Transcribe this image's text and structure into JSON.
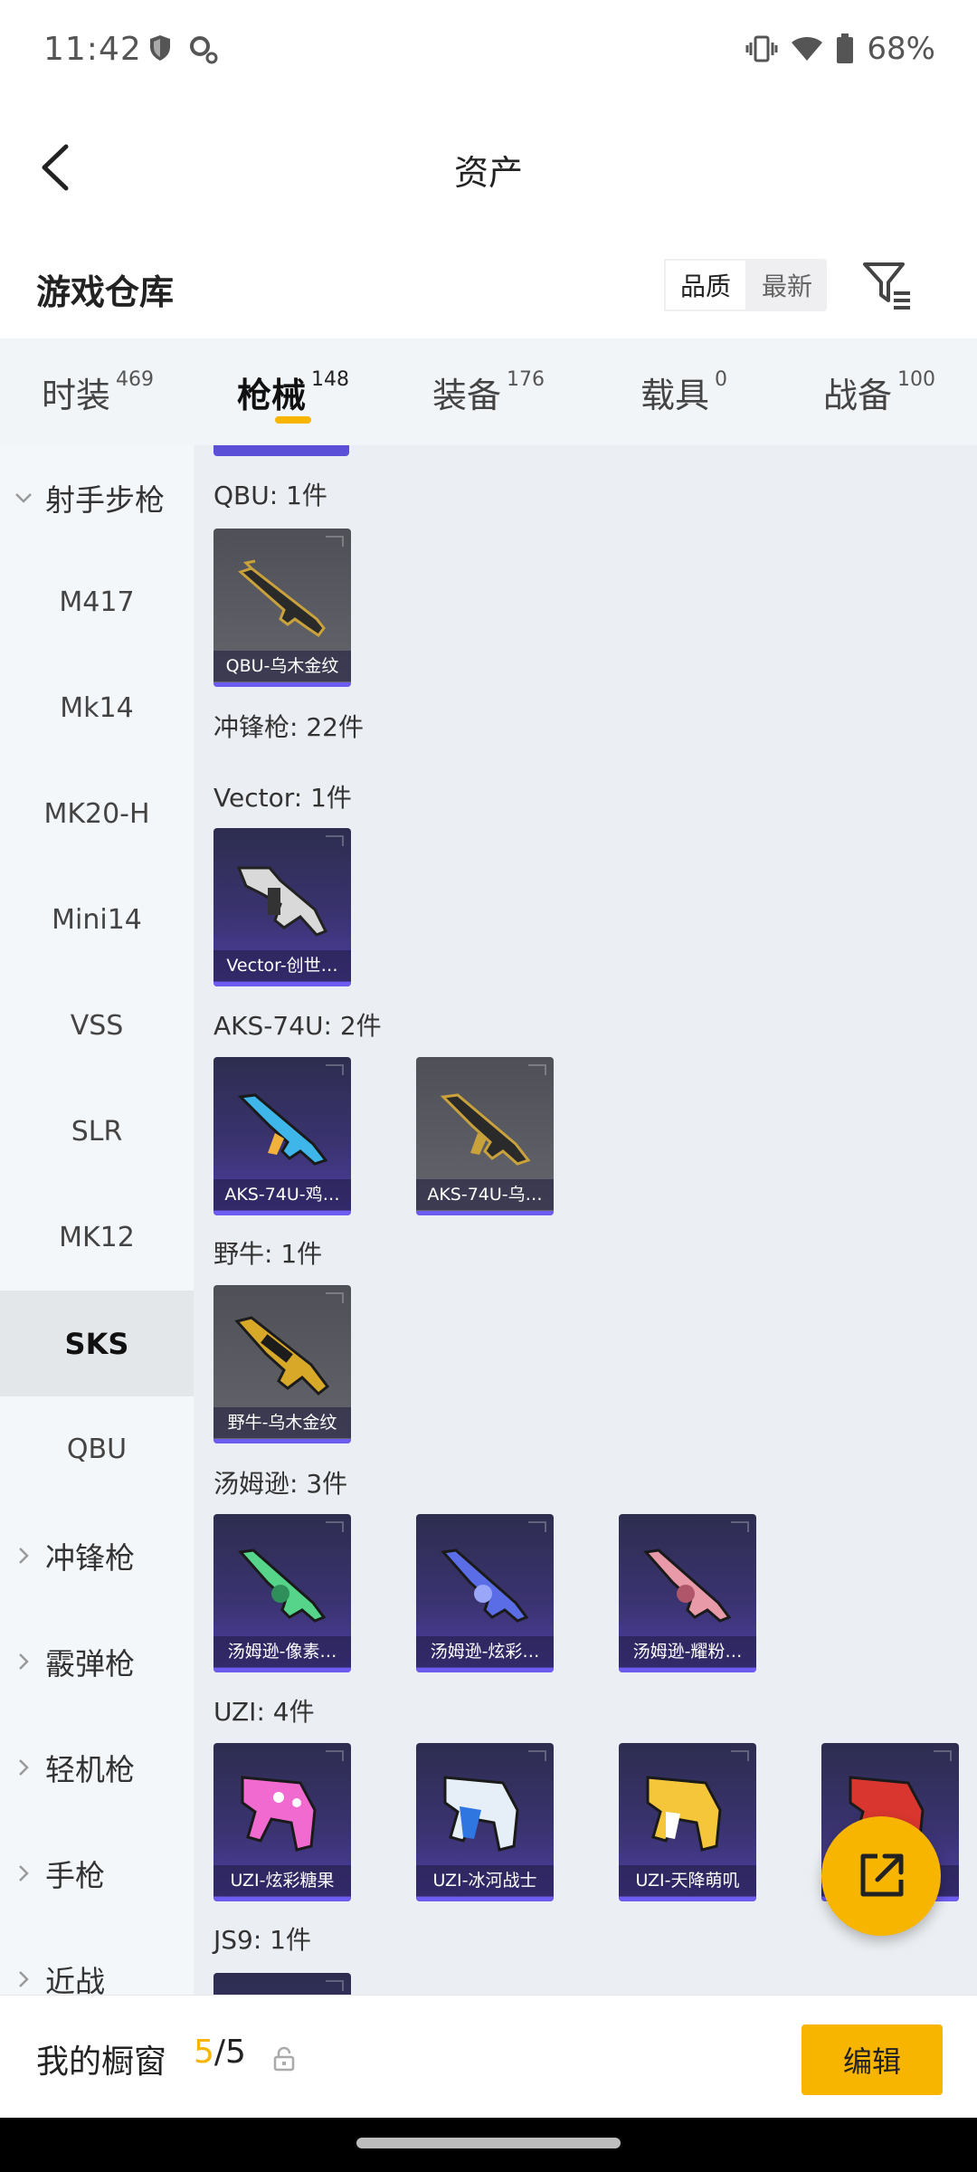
{
  "status_bar": {
    "time": "11:42",
    "battery": "68%",
    "icons": [
      "shield-icon",
      "key-icon",
      "vibrate-icon",
      "wifi-icon",
      "battery-icon"
    ]
  },
  "header": {
    "title": "资产",
    "back_icon": "chevron-left-icon"
  },
  "warehouse": {
    "title": "游戏仓库",
    "sort_options": [
      "品质",
      "最新"
    ],
    "active_sort": "品质",
    "filter_icon": "filter-icon"
  },
  "tabs": [
    {
      "label": "时装",
      "count": "469"
    },
    {
      "label": "枪械",
      "count": "148"
    },
    {
      "label": "装备",
      "count": "176"
    },
    {
      "label": "载具",
      "count": "0"
    },
    {
      "label": "战备",
      "count": "100"
    }
  ],
  "active_tab": "枪械",
  "sidebar": {
    "group_open": "射手步枪",
    "sub_items": [
      "M417",
      "Mk14",
      "MK20-H",
      "Mini14",
      "VSS",
      "SLR",
      "MK12",
      "SKS",
      "QBU"
    ],
    "active_item": "SKS",
    "groups": [
      "冲锋枪",
      "霰弹枪",
      "轻机枪",
      "手枪",
      "近战"
    ]
  },
  "content": {
    "labels": {
      "qbu": "QBU: 1件",
      "smg": "冲锋枪: 22件",
      "vector": "Vector: 1件",
      "aks": "AKS-74U: 2件",
      "bizon": "野牛: 1件",
      "tommy": "汤姆逊: 3件",
      "uzi": "UZI: 4件",
      "js9": "JS9: 1件"
    },
    "items": {
      "qbu1": "QBU-乌木金纹",
      "vector1": "Vector-创世…",
      "aks1": "AKS-74U-鸡…",
      "aks2": "AKS-74U-乌…",
      "bizon1": "野牛-乌木金纹",
      "tommy1": "汤姆逊-像素…",
      "tommy2": "汤姆逊-炫彩…",
      "tommy3": "汤姆逊-耀粉…",
      "uzi1": "UZI-炫彩糖果",
      "uzi2": "UZI-冰河战士",
      "uzi3": "UZI-天降萌叽",
      "uzi4": "…"
    }
  },
  "fab_icon": "share-external-icon",
  "bottom_bar": {
    "label": "我的橱窗",
    "count_current": "5",
    "count_sep_total": "/5",
    "lock_icon": "lock-icon",
    "edit_label": "编辑"
  },
  "colors": {
    "accent": "#f7b500",
    "rare_purple": "#6d5cf0"
  }
}
